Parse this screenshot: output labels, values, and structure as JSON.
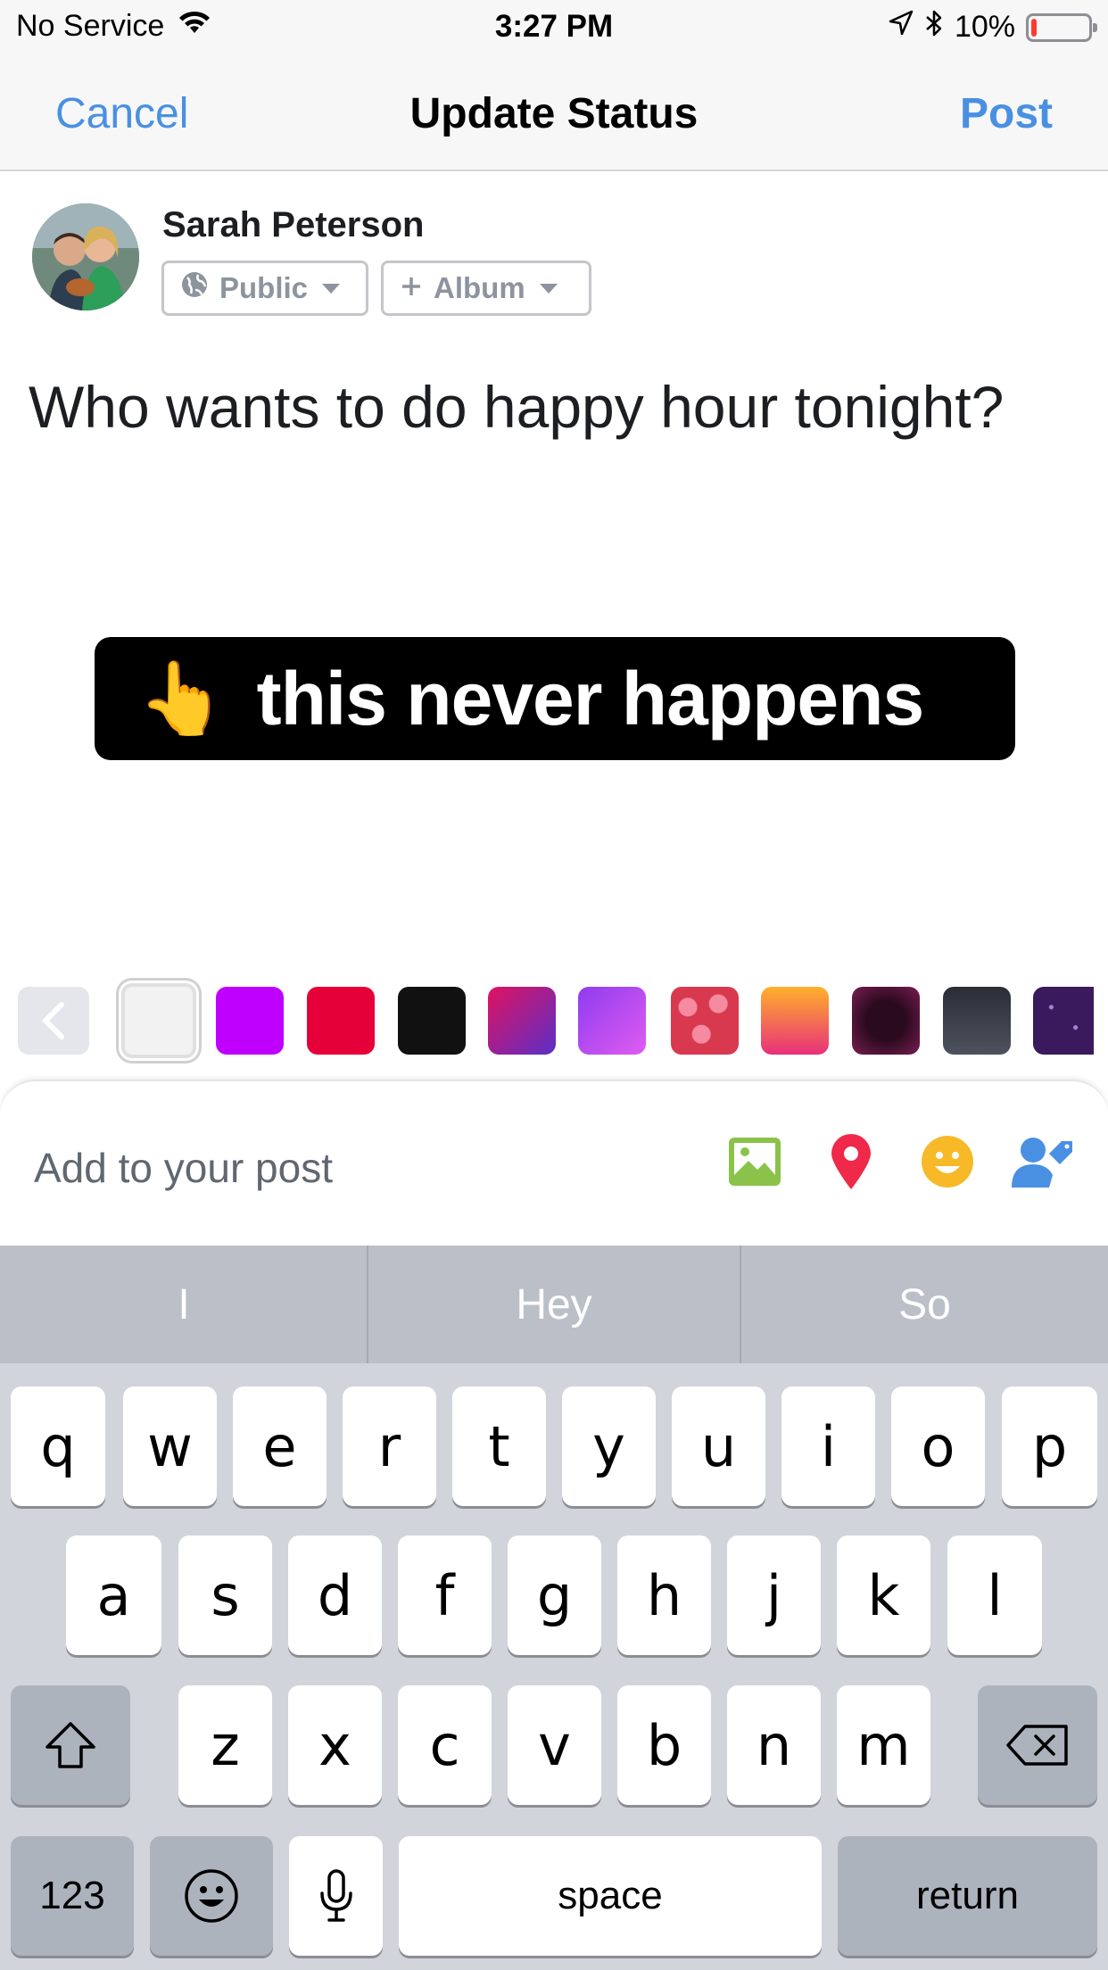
{
  "status_bar": {
    "carrier": "No Service",
    "time": "3:27 PM",
    "battery": "10%",
    "battery_level": 0.1,
    "icons": [
      "wifi-icon",
      "location-arrow-icon",
      "bluetooth-icon",
      "battery-icon"
    ]
  },
  "nav": {
    "cancel": "Cancel",
    "title": "Update Status",
    "post": "Post",
    "accent_color": "#4a90e2"
  },
  "composer": {
    "user_name": "Sarah Peterson",
    "privacy_label": "Public",
    "album_label": "Album",
    "post_text": "Who wants to do happy hour tonight?",
    "sticker": {
      "emoji": "👆",
      "text": "this never happens"
    }
  },
  "palette": {
    "swatches": [
      {
        "name": "white",
        "selected": true
      },
      {
        "name": "purple"
      },
      {
        "name": "red"
      },
      {
        "name": "black"
      },
      {
        "name": "magenta-blue-gradient"
      },
      {
        "name": "violet-gradient"
      },
      {
        "name": "hearts-pattern"
      },
      {
        "name": "sunset-gradient"
      },
      {
        "name": "dark-purple-pattern"
      },
      {
        "name": "charcoal-gradient"
      },
      {
        "name": "starry-night-pattern"
      }
    ]
  },
  "add_to_post": {
    "label": "Add to your post",
    "icons": [
      "photo-icon",
      "location-pin-icon",
      "feeling-smiley-icon",
      "tag-people-icon"
    ],
    "colors": {
      "photo": "#8bc34a",
      "location": "#f02849",
      "feeling": "#f7b928",
      "tag": "#4a90e2"
    }
  },
  "keyboard": {
    "suggestions": [
      "I",
      "Hey",
      "So"
    ],
    "row1": [
      "q",
      "w",
      "e",
      "r",
      "t",
      "y",
      "u",
      "i",
      "o",
      "p"
    ],
    "row2": [
      "a",
      "s",
      "d",
      "f",
      "g",
      "h",
      "j",
      "k",
      "l"
    ],
    "row3": [
      "z",
      "x",
      "c",
      "v",
      "b",
      "n",
      "m"
    ],
    "numbers_key": "123",
    "space_key": "space",
    "return_key": "return"
  }
}
